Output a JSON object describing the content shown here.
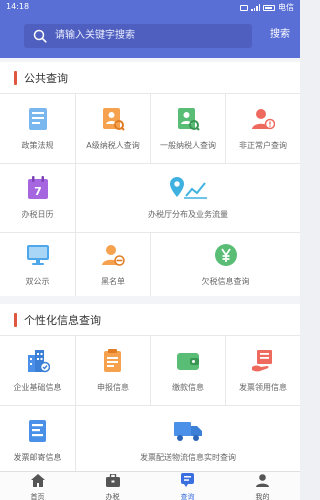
{
  "status_bar": {
    "time": "14:18",
    "carrier": "电信"
  },
  "search": {
    "placeholder": "请输入关键字搜索",
    "button_label": "搜索"
  },
  "public_query": {
    "title": "公共查询",
    "items": [
      {
        "label": "政策法规",
        "icon": "document-icon",
        "color": "#5aa3e8"
      },
      {
        "label": "A级纳税人查询",
        "icon": "person-search-icon",
        "color": "#f3923a"
      },
      {
        "label": "一般纳税人查询",
        "icon": "document-search-icon",
        "color": "#4cb06b"
      },
      {
        "label": "非正常户查询",
        "icon": "person-alert-icon",
        "color": "#e65a4f"
      },
      {
        "label": "办税日历",
        "icon": "calendar-icon",
        "color": "#9b5ad6",
        "calendar_day": "7"
      },
      {
        "label": "办税厅分布及业务流量",
        "icon": "map-pin-chart-icon",
        "color": "#38a8d8"
      },
      {
        "label": "双公示",
        "icon": "monitor-icon",
        "color": "#3b9be0"
      },
      {
        "label": "黑名单",
        "icon": "person-block-icon",
        "color": "#f3923a"
      },
      {
        "label": "欠税信息查询",
        "icon": "yen-coin-icon",
        "color": "#4cb06b"
      }
    ]
  },
  "personal_query": {
    "title": "个性化信息查询",
    "items": [
      {
        "label": "企业基础信息",
        "icon": "building-icon",
        "color": "#3b82e0"
      },
      {
        "label": "申报信息",
        "icon": "report-icon",
        "color": "#f3923a"
      },
      {
        "label": "缴款信息",
        "icon": "wallet-icon",
        "color": "#4cb06b"
      },
      {
        "label": "发票领用信息",
        "icon": "invoice-hand-icon",
        "color": "#e65a4f"
      },
      {
        "label": "发票邮寄信息",
        "icon": "list-icon",
        "color": "#3b82e0"
      },
      {
        "label": "发票配送物流信息实时查询",
        "icon": "truck-icon",
        "color": "#3b82e0"
      }
    ]
  },
  "tabbar": {
    "items": [
      {
        "label": "首页",
        "icon": "home-icon",
        "active": false
      },
      {
        "label": "办税",
        "icon": "briefcase-icon",
        "active": false
      },
      {
        "label": "查询",
        "icon": "search-list-icon",
        "active": true
      },
      {
        "label": "我的",
        "icon": "user-icon",
        "active": false
      }
    ]
  },
  "colors": {
    "header": "#5a6fd6",
    "accent_bar": "#e0573f",
    "tab_active": "#3b6fe0"
  }
}
